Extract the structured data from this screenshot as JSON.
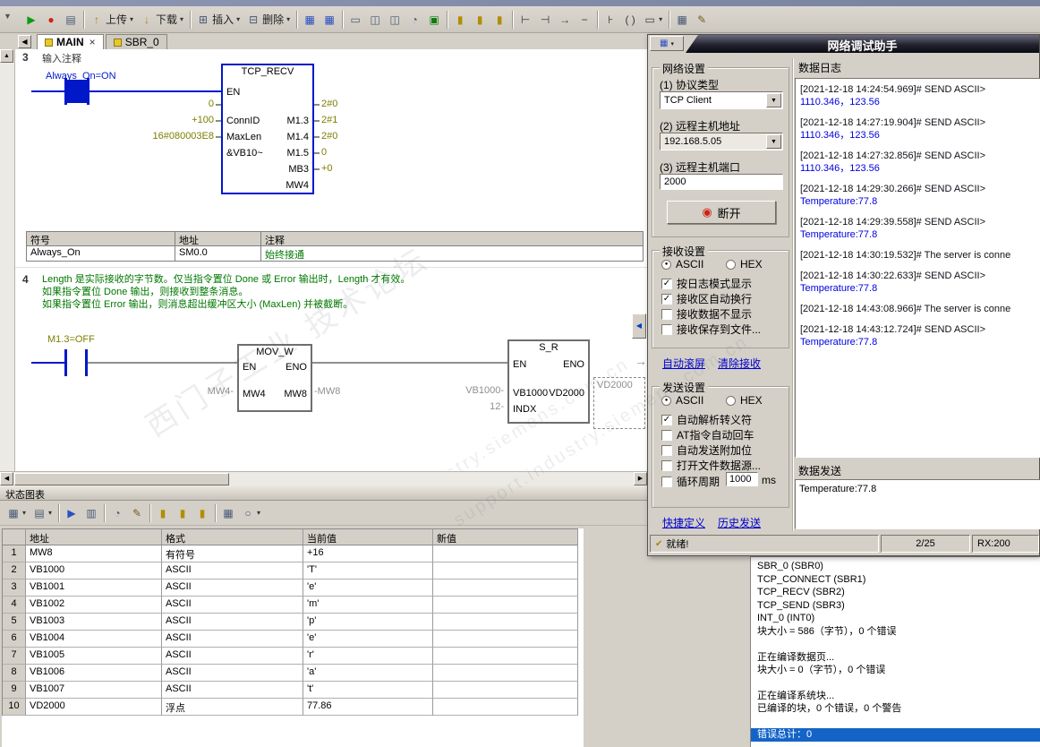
{
  "window": {
    "nav_left": "◀",
    "scroll_up": "▲",
    "scroll_left": "◀",
    "scroll_right": "▶",
    "splitter": "◀",
    "pin": "▼"
  },
  "watermark": {
    "line1": "西门子工业 技术论坛",
    "line2": "support.industry.siemens.com.cn"
  },
  "toolbar": {
    "buttons": [
      {
        "g": "▶",
        "s": "color:#0d9c0d"
      },
      {
        "g": "●",
        "s": "color:#cf2313"
      },
      {
        "g": "▤",
        "s": "color:#4a5a74"
      },
      {
        "g": "↑",
        "s": "color:#b57e00",
        "t": "上传",
        "cr": "▾"
      },
      {
        "g": "↓",
        "s": "color:#b57e00",
        "t": "下载",
        "cr": "▾"
      },
      {
        "g": "⊞",
        "s": "color:#4a5a74",
        "t": "插入",
        "cr": "▾"
      },
      {
        "g": "⊟",
        "s": "color:#4a5a74",
        "t": "删除",
        "cr": "▾"
      },
      {
        "g": "▦",
        "s": "color:#2a50c0"
      },
      {
        "g": "▦",
        "s": "color:#2a50c0"
      },
      {
        "g": "▭",
        "s": "color:#4a5a74"
      },
      {
        "g": "◫",
        "s": "color:#4a5a74"
      },
      {
        "g": "◫",
        "s": "color:#4a5a74"
      },
      {
        "g": "◔",
        "s": "color:#4a5a74"
      },
      {
        "g": "▣",
        "s": "color:#0d7c0d"
      },
      {
        "g": "▮",
        "s": "color:#b08e00"
      },
      {
        "g": "▮",
        "s": "color:#b08e00"
      },
      {
        "g": "▮",
        "s": "color:#b08e00"
      },
      {
        "g": "⊢",
        "s": "color:#3a3a3a"
      },
      {
        "g": "⊣",
        "s": "color:#3a3a3a"
      },
      {
        "g": "→",
        "s": "color:#3a3a3a"
      },
      {
        "g": "−",
        "s": "color:#3a3a3a"
      },
      {
        "g": "⊦",
        "s": "color:#3a3a3a"
      },
      {
        "g": "( )",
        "s": "color:#3a3a3a"
      },
      {
        "g": "▭",
        "s": "color:#3a3a3a",
        "cr": "▾"
      },
      {
        "g": "▦",
        "s": "color:#4a5a74"
      },
      {
        "g": "✎",
        "s": "color:#7a5a20"
      }
    ]
  },
  "tabs": [
    {
      "label": "MAIN",
      "close": "×"
    },
    {
      "label": "SBR_0"
    }
  ],
  "ladder": {
    "net3": {
      "num": "3",
      "comment": "输入注释",
      "contact": "Always_On=ON",
      "title": "TCP_RECV",
      "en": "EN",
      "in": [
        {
          "v": "0",
          "p": "ConnID"
        },
        {
          "v": "+100",
          "p": "MaxLen"
        },
        {
          "v": "16#080003E8",
          "p": "&VB10~"
        }
      ],
      "out": [
        {
          "p": "M1.3",
          "v": "2#0"
        },
        {
          "p": "M1.4",
          "v": "2#1"
        },
        {
          "p": "M1.5",
          "v": "2#0"
        },
        {
          "p": "MB3",
          "v": "0"
        },
        {
          "p": "MW4",
          "v": "+0"
        }
      ],
      "sym": {
        "h1": "符号",
        "h2": "地址",
        "h3": "注释",
        "r1": "Always_On",
        "r2": "SM0.0",
        "r3": "始终接通"
      }
    },
    "net4": {
      "num": "4",
      "c1": "Length 是实际接收的字节数。仅当指令置位 Done 或 Error 输出时，Length 才有效。",
      "c2": "如果指令置位 Done 输出，则接收到整条消息。",
      "c3": "如果指令置位 Error 输出，则消息超出缓冲区大小 (MaxLen) 并被截断。",
      "contact": "M1.3=OFF",
      "mov": {
        "title": "MOV_W",
        "en": "EN",
        "eno": "ENO",
        "inL": "MW4-",
        "pinL": "MW4",
        "pinR": "MW8",
        "outR": "-MW8"
      },
      "sr": {
        "title": "S_R",
        "en": "EN",
        "eno": "ENO",
        "inL": "VB1000-",
        "pinL": "VB1000",
        "pinR": "VD2000",
        "indxL": "12-",
        "pinL2": "INDX",
        "sel": "VD2000",
        "arrow": "→"
      }
    }
  },
  "chart": {
    "title": "状态图表",
    "ctb": [
      {
        "g": "▦",
        "s": "color:#4a5a74",
        "cr": "▾"
      },
      {
        "g": "▤",
        "s": "color:#4a5a74",
        "cr": "▾"
      },
      {
        "g": "▶",
        "s": "color:#2a50c0"
      },
      {
        "g": "▥",
        "s": "color:#4a5a74"
      },
      {
        "g": "◔",
        "s": "color:#4a5a74"
      },
      {
        "g": "✎",
        "s": "color:#7a5a20"
      },
      {
        "g": "▮",
        "s": "color:#b08e00"
      },
      {
        "g": "▮",
        "s": "color:#b08e00"
      },
      {
        "g": "▮",
        "s": "color:#b08e00"
      },
      {
        "g": "▦",
        "s": "color:#4a5a74"
      },
      {
        "g": "○",
        "s": "color:#4a5a74",
        "cr": "▾"
      }
    ],
    "headers": {
      "addr": "地址",
      "fmt": "格式",
      "cur": "当前值",
      "new": "新值"
    },
    "rows": [
      {
        "n": "1",
        "a": "MW8",
        "f": "有符号",
        "c": "+16",
        "nv": ""
      },
      {
        "n": "2",
        "a": "VB1000",
        "f": "ASCII",
        "c": "'T'",
        "nv": ""
      },
      {
        "n": "3",
        "a": "VB1001",
        "f": "ASCII",
        "c": "'e'",
        "nv": ""
      },
      {
        "n": "4",
        "a": "VB1002",
        "f": "ASCII",
        "c": "'m'",
        "nv": ""
      },
      {
        "n": "5",
        "a": "VB1003",
        "f": "ASCII",
        "c": "'p'",
        "nv": ""
      },
      {
        "n": "6",
        "a": "VB1004",
        "f": "ASCII",
        "c": "'e'",
        "nv": ""
      },
      {
        "n": "7",
        "a": "VB1005",
        "f": "ASCII",
        "c": "'r'",
        "nv": ""
      },
      {
        "n": "8",
        "a": "VB1006",
        "f": "ASCII",
        "c": "'a'",
        "nv": ""
      },
      {
        "n": "9",
        "a": "VB1007",
        "f": "ASCII",
        "c": "'t'",
        "nv": ""
      },
      {
        "n": "10",
        "a": "VD2000",
        "f": "浮点",
        "c": "77.86",
        "nv": ""
      }
    ]
  },
  "assistant": {
    "title": "网络调试助手",
    "menu_icon": "▦",
    "menu_caret": "▾",
    "net": {
      "title": "网络设置",
      "l1": "(1) 协议类型",
      "v1": "TCP Client",
      "l2": "(2) 远程主机地址",
      "v2": "192.168.5.05",
      "l3": "(3) 远程主机端口",
      "v3": "2000",
      "btn": "断开",
      "btn_icon": "◉"
    },
    "recv": {
      "title": "接收设置",
      "ascii": "ASCII",
      "hex": "HEX",
      "ascii_dot": "●",
      "hex_dot": "",
      "checks": [
        {
          "label": "按日志模式显示",
          "mark": "✓"
        },
        {
          "label": "接收区自动换行",
          "mark": "✓"
        },
        {
          "label": "接收数据不显示",
          "mark": ""
        },
        {
          "label": "接收保存到文件...",
          "mark": ""
        }
      ],
      "link1": "自动滚屏",
      "link2": "清除接收"
    },
    "send": {
      "title": "发送设置",
      "ascii": "ASCII",
      "hex": "HEX",
      "ascii_dot": "●",
      "hex_dot": "",
      "checks": [
        {
          "label": "自动解析转义符",
          "mark": "✓"
        },
        {
          "label": "AT指令自动回车",
          "mark": ""
        },
        {
          "label": "自动发送附加位",
          "mark": ""
        },
        {
          "label": "打开文件数据源...",
          "mark": ""
        },
        {
          "label": "循环周期",
          "mark": ""
        }
      ],
      "cycle": "1000",
      "unit": "ms",
      "link1": "快捷定义",
      "link2": "历史发送"
    },
    "log_title": "数据日志",
    "log": [
      {
        "ts": "[2021-12-18 14:24:54.969]# SEND ASCII>",
        "msg": "1110.346，123.56"
      },
      {
        "ts": "[2021-12-18 14:27:19.904]# SEND ASCII>",
        "msg": "1110.346，123.56"
      },
      {
        "ts": "[2021-12-18 14:27:32.856]# SEND ASCII>",
        "msg": "1110.346，123.56"
      },
      {
        "ts": "[2021-12-18 14:29:30.266]# SEND ASCII>",
        "msg": "Temperature:77.8"
      },
      {
        "ts": "[2021-12-18 14:29:39.558]# SEND ASCII>",
        "msg": "Temperature:77.8"
      },
      {
        "ts": "[2021-12-18 14:30:19.532]# The server is conne",
        "msg": ""
      },
      {
        "ts": "[2021-12-18 14:30:22.633]# SEND ASCII>",
        "msg": "Temperature:77.8"
      },
      {
        "ts": "[2021-12-18 14:43:08.966]# The server is conne",
        "msg": ""
      },
      {
        "ts": "[2021-12-18 14:43:12.724]# SEND ASCII>",
        "msg": "Temperature:77.8"
      }
    ],
    "send_title": "数据发送",
    "send_text": "Temperature:77.8",
    "status": {
      "icon": "✔",
      "ready": "就绪!",
      "count": "2/25",
      "rx": "RX:200"
    }
  },
  "output": {
    "lines": [
      "SBR_0 (SBR0)",
      "TCP_CONNECT (SBR1)",
      "TCP_RECV (SBR2)",
      "TCP_SEND (SBR3)",
      "INT_0 (INT0)",
      "块大小 = 586（字节），0 个错误",
      "",
      "正在编译数据页...",
      "块大小 = 0（字节），0 个错误",
      "",
      "正在编译系统块...",
      "已编译的块，0 个错误，0 个警告",
      ""
    ],
    "highlight": "错误总计：0"
  }
}
